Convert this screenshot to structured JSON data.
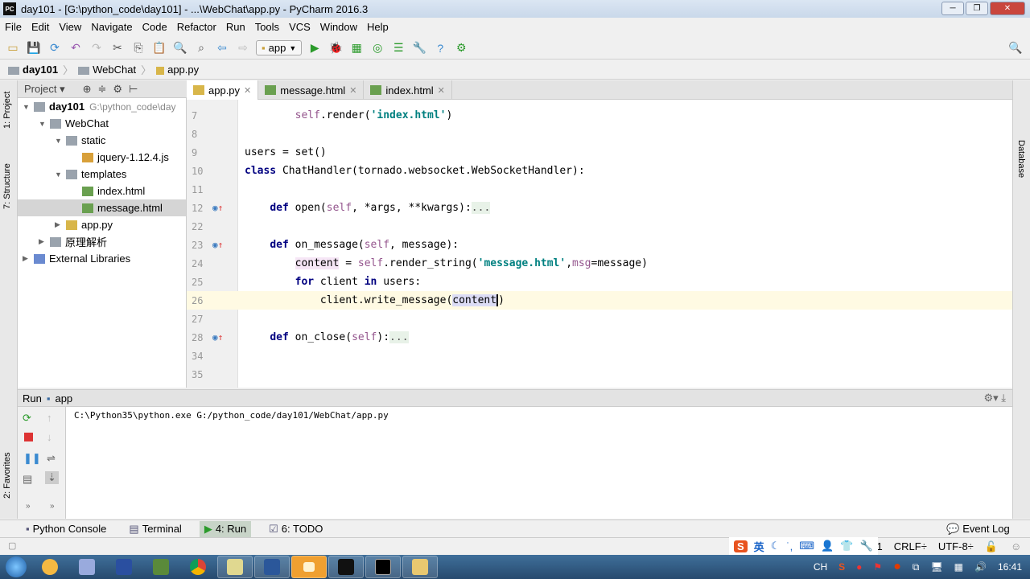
{
  "window": {
    "title": "day101 - [G:\\python_code\\day101] - ...\\WebChat\\app.py - PyCharm 2016.3",
    "icon": "PC"
  },
  "menu": [
    "File",
    "Edit",
    "View",
    "Navigate",
    "Code",
    "Refactor",
    "Run",
    "Tools",
    "VCS",
    "Window",
    "Help"
  ],
  "toolbar": {
    "run_config": "app"
  },
  "breadcrumb": [
    "day101",
    "WebChat",
    "app.py"
  ],
  "left_stripe": [
    "1: Project",
    "7: Structure",
    "2: Favorites"
  ],
  "right_stripe": [
    "Database"
  ],
  "project": {
    "header": "Project",
    "tree": [
      {
        "label": "day101",
        "extra": "G:\\python_code\\day",
        "depth": 0,
        "type": "folder",
        "open": true,
        "bold": true
      },
      {
        "label": "WebChat",
        "depth": 1,
        "type": "folder",
        "open": true
      },
      {
        "label": "static",
        "depth": 2,
        "type": "folder",
        "open": true
      },
      {
        "label": "jquery-1.12.4.js",
        "depth": 3,
        "type": "js"
      },
      {
        "label": "templates",
        "depth": 2,
        "type": "folder",
        "open": true
      },
      {
        "label": "index.html",
        "depth": 3,
        "type": "html"
      },
      {
        "label": "message.html",
        "depth": 3,
        "type": "html",
        "selected": true
      },
      {
        "label": "app.py",
        "depth": 2,
        "type": "py",
        "closed": true
      },
      {
        "label": "原理解析",
        "depth": 1,
        "type": "folder",
        "closed": true
      },
      {
        "label": "External Libraries",
        "depth": 0,
        "type": "lib",
        "closed": true
      }
    ]
  },
  "tabs": [
    {
      "label": "app.py",
      "active": true
    },
    {
      "label": "message.html"
    },
    {
      "label": "index.html"
    }
  ],
  "editor": {
    "lines": [
      {
        "n": "7",
        "html": "        <span class='slf'>self</span>.render(<span class='str'>'index.html'</span>)"
      },
      {
        "n": "8",
        "html": ""
      },
      {
        "n": "9",
        "html": "users = set()"
      },
      {
        "n": "10",
        "html": "<span class='kw'>class</span> ChatHandler(tornado.websocket.WebSocketHandler):"
      },
      {
        "n": "11",
        "html": ""
      },
      {
        "n": "12",
        "html": "    <span class='kw'>def</span> open(<span class='slf'>self</span>, *args, **kwargs):<span class='fold'>...</span>",
        "mark": true
      },
      {
        "n": "22",
        "html": ""
      },
      {
        "n": "23",
        "html": "    <span class='kw'>def</span> on_message(<span class='slf'>self</span>, message):",
        "mark": true
      },
      {
        "n": "24",
        "html": "        <span class='hlv'>content</span> = <span class='slf'>self</span>.render_string(<span class='str'>'message.html'</span>,<span class='slf'>msg</span>=message)"
      },
      {
        "n": "25",
        "html": "        <span class='kw'>for</span> client <span class='kw'>in</span> users:"
      },
      {
        "n": "26",
        "html": "            client.write_message(<span class='hlu'>content</span>|)",
        "current": true
      },
      {
        "n": "27",
        "html": ""
      },
      {
        "n": "28",
        "html": "    <span class='kw'>def</span> on_close(<span class='slf'>self</span>):<span class='fold'>...</span>",
        "mark": true
      },
      {
        "n": "34",
        "html": ""
      },
      {
        "n": "35",
        "html": ""
      }
    ]
  },
  "run": {
    "label": "Run",
    "config": "app",
    "output": "C:\\Python35\\python.exe G:/python_code/day101/WebChat/app.py"
  },
  "bottom_tabs": [
    {
      "label": "Python Console"
    },
    {
      "label": "Terminal"
    },
    {
      "label": "4: Run",
      "active": true
    },
    {
      "label": "6: TODO"
    }
  ],
  "status": {
    "event_log": "Event Log",
    "position": "26:41",
    "line_sep": "CRLF÷",
    "encoding": "UTF-8÷"
  },
  "ime": {
    "lang": "英"
  },
  "tray": {
    "lang": "CH",
    "time": "16:41"
  }
}
